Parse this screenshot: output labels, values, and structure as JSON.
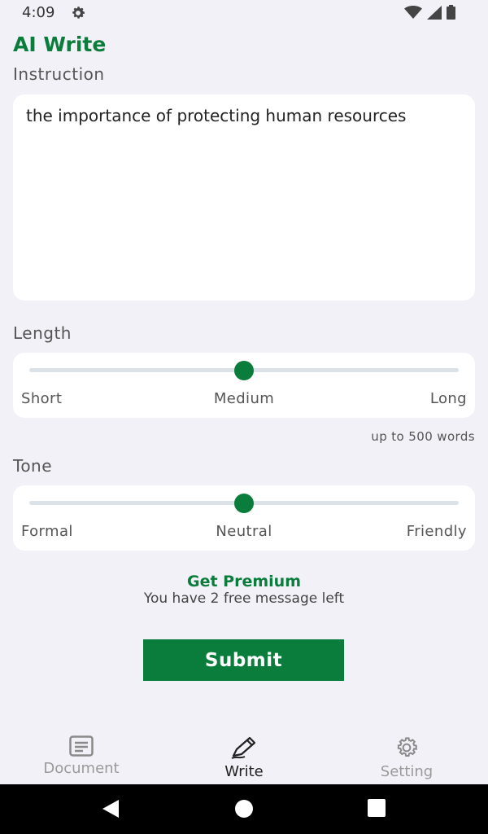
{
  "status_bar": {
    "time": "4:09",
    "icons": [
      "gear-icon",
      "wifi-icon",
      "signal-icon",
      "battery-icon"
    ]
  },
  "header": {
    "title": "AI Write"
  },
  "instruction": {
    "label": "Instruction",
    "value": "the importance of protecting human resources"
  },
  "length": {
    "label": "Length",
    "options": [
      "Short",
      "Medium",
      "Long"
    ],
    "selected": "Medium",
    "level": 0.5,
    "hint": "up to 500 words"
  },
  "tone": {
    "label": "Tone",
    "options": [
      "Formal",
      "Neutral",
      "Friendly"
    ],
    "selected": "Neutral",
    "level": 0.5
  },
  "premium": {
    "link": "Get Premium",
    "message": "You have 2 free message left"
  },
  "submit_label": "Submit",
  "bottom_nav": {
    "items": [
      {
        "label": "Document",
        "icon": "document-icon",
        "active": false
      },
      {
        "label": "Write",
        "icon": "pen-icon",
        "active": true
      },
      {
        "label": "Setting",
        "icon": "gear-icon",
        "active": false
      }
    ]
  },
  "colors": {
    "accent": "#0a7d3c",
    "background": "#f2f1f7",
    "card": "#ffffff",
    "track": "#dbe3e8"
  }
}
